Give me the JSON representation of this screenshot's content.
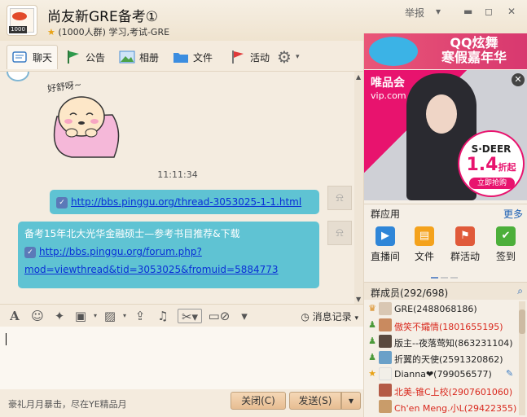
{
  "window": {
    "title": "尚友新GRE备考①",
    "subtitle": "(1000人群) 学习,考试-GRE",
    "avatar_badge": "1000",
    "report_label": "举报",
    "dropdown_label": "▾",
    "minimize_label": "▬",
    "maximize_label": "◻",
    "close_label": "✕"
  },
  "tabs": [
    {
      "label": "聊天",
      "icon": "chat-icon",
      "color": "#3a7cc4"
    },
    {
      "label": "公告",
      "icon": "flag-icon",
      "color": "#2e9a4c"
    },
    {
      "label": "相册",
      "icon": "photo-icon",
      "color": "#4a8fd4"
    },
    {
      "label": "文件",
      "icon": "folder-icon",
      "color": "#3b8de0"
    },
    {
      "label": "活动",
      "icon": "red-flag-icon",
      "color": "#e0393a"
    },
    {
      "label": "⚙",
      "icon": "gear-icon",
      "color": "#666"
    }
  ],
  "chat": {
    "sticker_text": "好舒呀~",
    "timestamp": "11:11:34",
    "messages": [
      {
        "link": "http://bbs.pinggu.org/thread-3053025-1-1.html"
      },
      {
        "line1": "备考15年北大光华金融硕士—参考书目推荐&下载",
        "link_a": "http://bbs.pinggu.org/forum.php?",
        "link_b": "mod=viewthread&tid=3053025&fromuid=5884773"
      }
    ]
  },
  "toolbar": {
    "history_label": "消息记录",
    "icons": [
      "font-icon",
      "emoji-icon",
      "magic-icon",
      "gift-icon",
      "image-icon",
      "upload-icon",
      "music-icon",
      "screenshot-icon",
      "block-icon"
    ]
  },
  "footer": {
    "text": "豪礼月月暴击，尽在YE精品月",
    "close_label": "关闭(C)",
    "send_label": "发送(S)",
    "send_dropdown": "▾"
  },
  "ads": {
    "top_text_1": "QQ炫舞",
    "top_text_2": "寒假嘉年华",
    "vip_logo_1": "唯品会",
    "vip_logo_2": "vip.com",
    "brand": "S·DEER",
    "discount": "1.4",
    "discount_unit": "折起",
    "cta": "立即抢购",
    "close": "✕"
  },
  "apps": {
    "title": "群应用",
    "more": "更多",
    "items": [
      {
        "label": "直播间",
        "color": "#2f86d8",
        "glyph": "▶"
      },
      {
        "label": "文件",
        "color": "#f4a21c",
        "glyph": "▤"
      },
      {
        "label": "群活动",
        "color": "#e05a3a",
        "glyph": "⚑"
      },
      {
        "label": "签到",
        "color": "#4caf3a",
        "glyph": "✔"
      }
    ]
  },
  "members": {
    "title": "群成员(292/698)",
    "list": [
      {
        "name": "GRE(2488068186)",
        "color": "#222",
        "role": "owner",
        "avatar": "#d9c7b3"
      },
      {
        "name": "傲笑不孀情(1801655195)",
        "color": "#d9291e",
        "role": "admin",
        "avatar": "#c98a5f"
      },
      {
        "name": "版主--夜落莺知(863231104)",
        "color": "#222",
        "role": "admin",
        "avatar": "#5a4a3f"
      },
      {
        "name": "折翼的天使(2591320862)",
        "color": "#222",
        "role": "admin",
        "avatar": "#6aa0c8"
      },
      {
        "name": "Dianna❤(799056577)",
        "color": "#222",
        "role": "star",
        "avatar": "#f2efe8"
      },
      {
        "name": "北美-锥C上校(2907601060)",
        "color": "#d9291e",
        "role": "none",
        "avatar": "#b45a46"
      },
      {
        "name": "Ch'en Meng.小L(29422355)",
        "color": "#d9291e",
        "role": "none",
        "avatar": "#c99c6a"
      }
    ]
  }
}
